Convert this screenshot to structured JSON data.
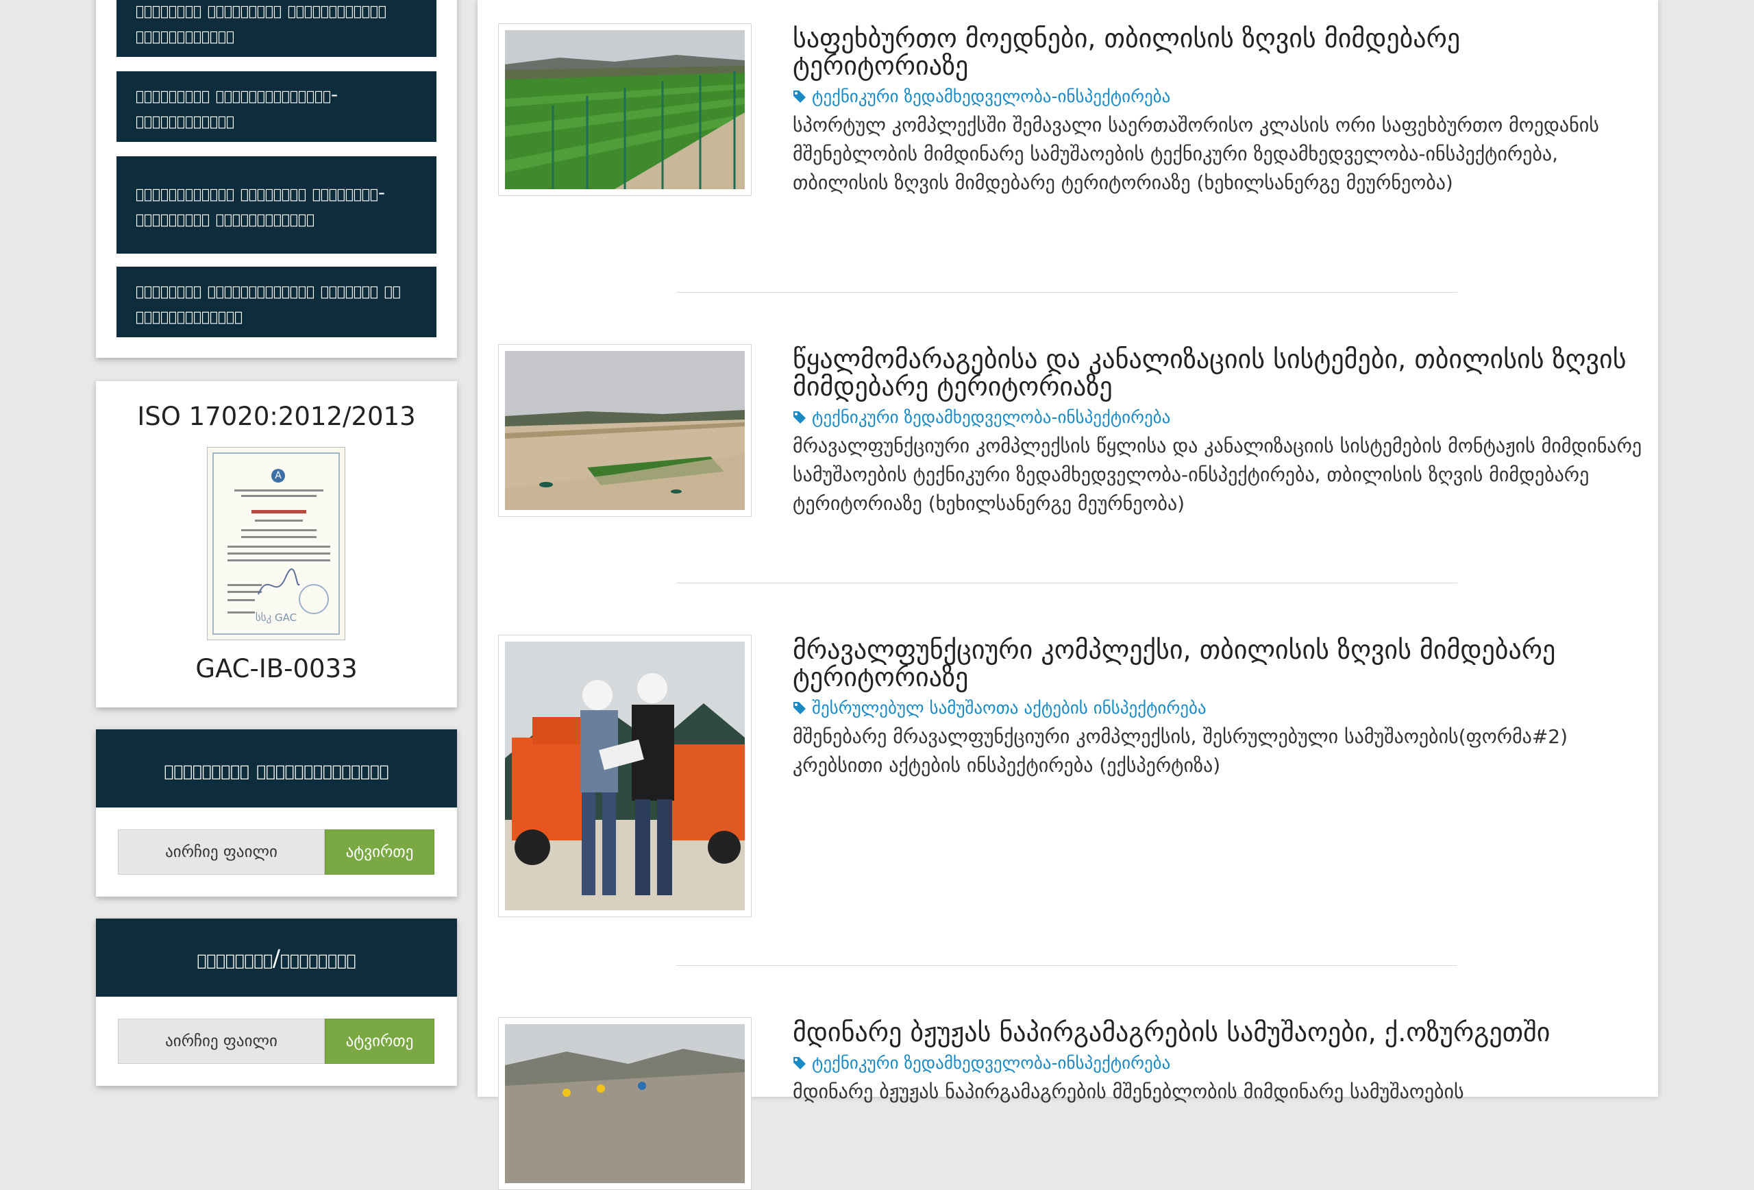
{
  "sidebar": {
    "menu_items": [
      {
        "label": "ობიექტის ტექნიკური მდგომარეობის ინსპექტირება"
      },
      {
        "label": "ტექნიკური ზედამხედველობა-ინსპექტირება"
      },
      {
        "label": "საინვესტიციო პროექტის ტექნიკურ-ფინანსური ინსპექტირება"
      },
      {
        "label": "ნარდობის ხელშეკრულების ანალიზი და კონსულტაციები"
      }
    ],
    "iso": {
      "title": "ISO 17020:2012/2013",
      "code": "GAC-IB-0033",
      "certificate_text": "სსკ GAC"
    },
    "forms": [
      {
        "title": "განაცხადი ინსპექტირებაზე",
        "file_label": "აირჩიე ფაილი",
        "button": "ატვირთე"
      },
      {
        "title": "საჩივარი/აპელაცია",
        "file_label": "აირჩიე ფაილი",
        "button": "ატვირთე"
      }
    ]
  },
  "articles": [
    {
      "title": "საფეხბურთო მოედნები, თბილისის ზღვის მიმდებარე ტერიტორიაზე",
      "category": "ტექნიკური ზედამხედველობა-ინსპექტირება",
      "description": "სპორტულ კომპლექსში შემავალი საერთაშორისო კლასის ორი საფეხბურთო მოედანის მშენებლობის მიმდინარე სამუშაოების ტექნიკური ზედამხედველობა-ინსპექტირება, თბილისის ზღვის მიმდებარე ტერიტორიაზე (ხეხილსანერგე მეურნეობა)"
    },
    {
      "title": "წყალმომარაგებისა და კანალიზაციის სისტემები, თბილისის ზღვის მიმდებარე ტერიტორიაზე",
      "category": "ტექნიკური ზედამხედველობა-ინსპექტირება",
      "description": "მრავალფუნქციური კომპლექსის წყლისა და კანალიზაციის სისტემების მონტაჟის მიმდინარე სამუშაოების ტექნიკური ზედამხედველობა-ინსპექტირება, თბილისის ზღვის მიმდებარე ტერიტორიაზე (ხეხილსანერგე მეურნეობა)"
    },
    {
      "title": "მრავალფუნქციური კომპლექსი, თბილისის ზღვის მიმდებარე ტერიტორიაზე",
      "category": "შესრულებულ სამუშაოთა აქტების ინსპექტირება",
      "description": "მშენებარე მრავალფუნქციური კომპლექსის, შესრულებული სამუშაოების(ფორმა#2) კრებსითი აქტების ინსპექტირება (ექსპერტიზა)"
    },
    {
      "title": "მდინარე ბჟუჟას ნაპირგამაგრების სამუშაოები, ქ.ოზურგეთში",
      "category": "ტექნიკური ზედამხედველობა-ინსპექტირება",
      "description": "მდინარე ბჟუჟას ნაპირგამაგრების მშენებლობის მიმდინარე სამუშაოების"
    }
  ]
}
